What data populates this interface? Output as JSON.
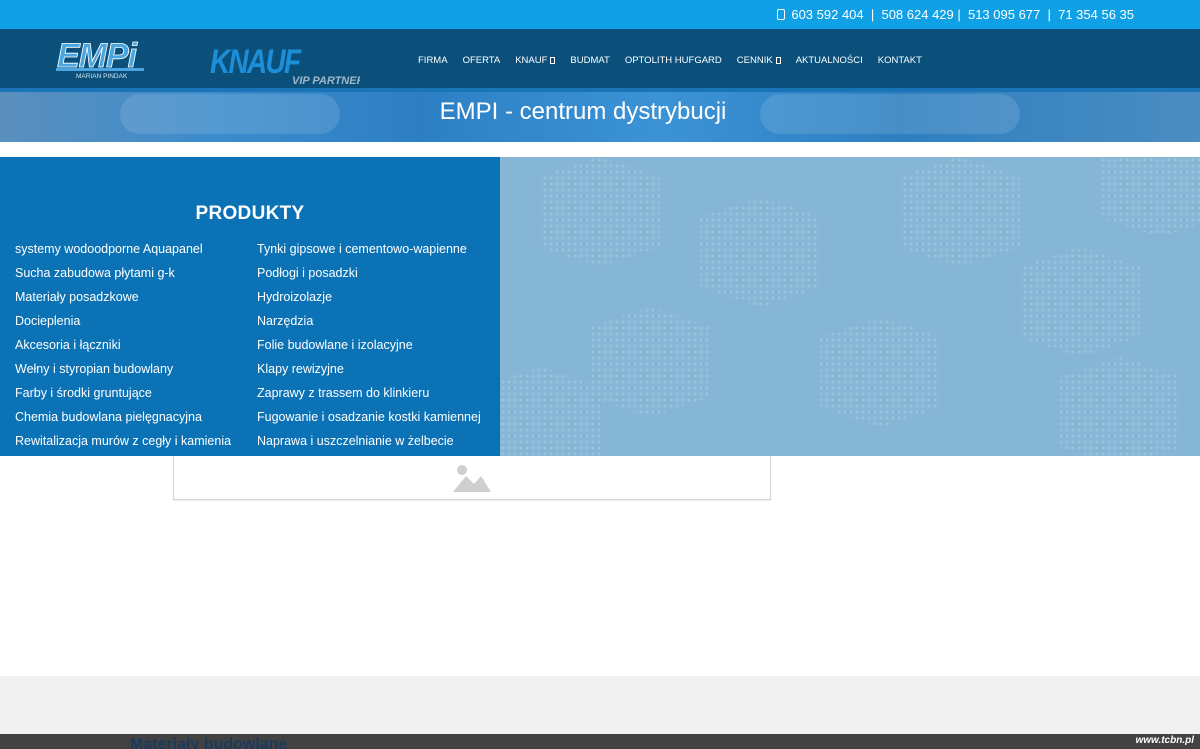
{
  "topbar": {
    "phones": "603 592 404  |  508 624 429 |  513 095 677  |  71 354 56 35"
  },
  "logos": {
    "empi": "EMPi",
    "empi_subtitle": "MARIAN PINDAK",
    "knauf": "KNAUF",
    "knauf_subtitle": "VIP PARTNER"
  },
  "nav": {
    "items": [
      {
        "label": "FIRMA",
        "dropdown": false
      },
      {
        "label": "OFERTA",
        "dropdown": false
      },
      {
        "label": "KNAUF",
        "dropdown": true
      },
      {
        "label": "BUDMAT",
        "dropdown": false
      },
      {
        "label": "OPTOLITH HUFGARD",
        "dropdown": false
      },
      {
        "label": "CENNIK",
        "dropdown": true
      },
      {
        "label": "AKTUALNOŚCI",
        "dropdown": false
      },
      {
        "label": "KONTAKT",
        "dropdown": false
      }
    ]
  },
  "hero": {
    "title": "EMPI - centrum dystrybucji"
  },
  "products": {
    "heading": "PRODUKTY",
    "left": [
      "systemy wodoodporne Aquapanel",
      "Sucha zabudowa płytami g-k",
      "Materiały posadzkowe",
      "Docieplenia",
      "Akcesoria i łączniki",
      "Wełny i styropian budowlany",
      "Farby i środki gruntujące",
      "Chemia budowlana pielęgnacyjna",
      "Rewitalizacja murów z cegły i kamienia"
    ],
    "right": [
      "Tynki gipsowe i cementowo-wapienne",
      "Podłogi i posadzki",
      "Hydroizolazje",
      "Narzędzia",
      "Folie budowlane i izolacyjne",
      "Klapy rewizyjne",
      "Zaprawy z trassem do klinkieru",
      "Fugowanie i osadzanie kostki kamiennej",
      "Naprawa i uszczelnianie w żelbecie"
    ]
  },
  "footer": {
    "heading": "Materiały budowlane",
    "watermark": "www.tcbn.pl"
  },
  "colors": {
    "topbar": "#10a0e6",
    "navbar": "#0a507b",
    "products_panel": "#0b72b6",
    "pattern_panel": "#86b6d6"
  }
}
